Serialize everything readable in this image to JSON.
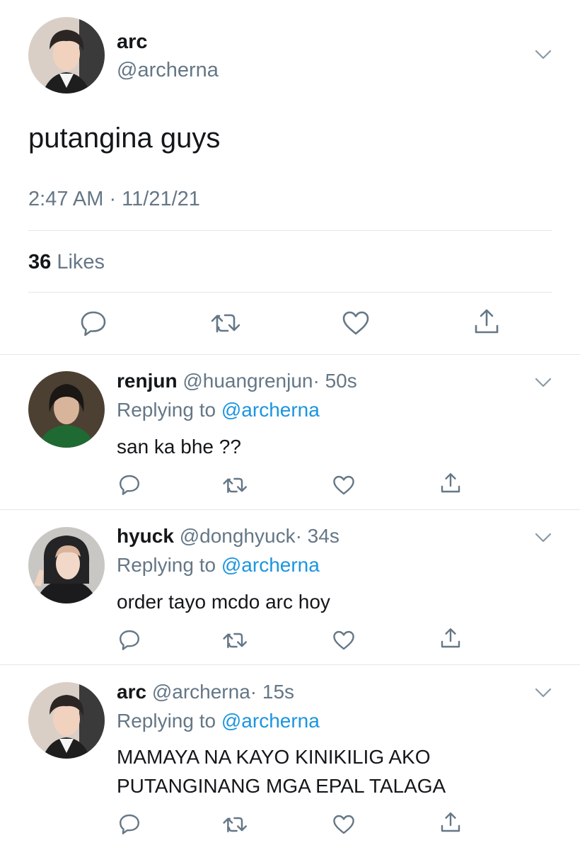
{
  "main_tweet": {
    "name": "arc",
    "handle": "@archerna",
    "text": "putangina guys",
    "timestamp": "2:47 AM · 11/21/21",
    "likes_count": "36",
    "likes_label": "Likes"
  },
  "replies": [
    {
      "name": "renjun",
      "handle": "@huangrenjun",
      "time": "· 50s",
      "replying_label": "Replying to",
      "replying_handle": "@archerna",
      "text": "san ka bhe ??"
    },
    {
      "name": "hyuck",
      "handle": "@donghyuck",
      "time": "· 34s",
      "replying_label": "Replying to",
      "replying_handle": "@archerna",
      "text": "order tayo mcdo arc hoy"
    },
    {
      "name": "arc",
      "handle": "@archerna",
      "time": "· 15s",
      "replying_label": "Replying to",
      "replying_handle": "@archerna",
      "text_line1": "MAMAYA NA KAYO KINIKILIG AKO",
      "text_line2": "PUTANGINANG MGA EPAL TALAGA"
    }
  ],
  "icons": {
    "reply": "reply-icon",
    "retweet": "retweet-icon",
    "like": "heart-icon",
    "share": "share-icon",
    "more": "chevron-down-icon"
  },
  "colors": {
    "link": "#1b95e0",
    "secondary_text": "#657786",
    "divider": "#e1e8ed"
  }
}
